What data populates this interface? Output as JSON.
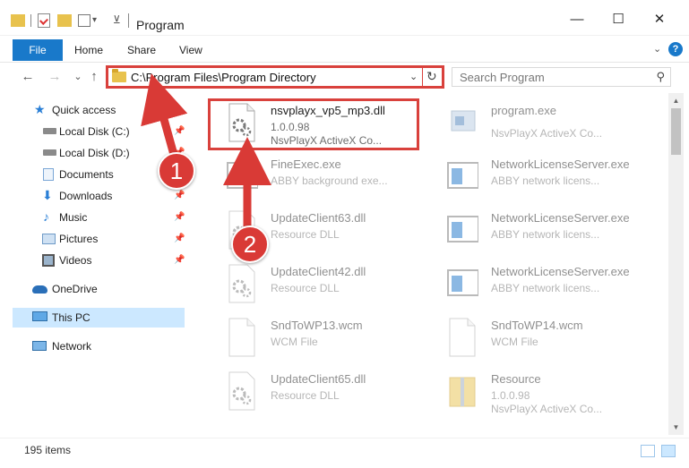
{
  "window": {
    "title": "Program",
    "min_glyph": "—",
    "max_glyph": "☐",
    "close_glyph": "✕"
  },
  "ribbon": {
    "file_label": "File",
    "tabs": [
      "Home",
      "Share",
      "View"
    ],
    "expand_glyph": "⌄",
    "help_glyph": "?"
  },
  "nav": {
    "back_glyph": "←",
    "forward_glyph": "→",
    "recent_glyph": "⌄",
    "up_glyph": "↑"
  },
  "address": {
    "path": "C:\\Program Files\\Program Directory",
    "dropdown_glyph": "⌄",
    "refresh_glyph": "↻"
  },
  "search": {
    "placeholder": "Search Program",
    "icon_glyph": "⚲"
  },
  "sidebar": {
    "items": [
      {
        "label": "Quick access",
        "icon": "star-icon",
        "pinned": false
      },
      {
        "label": "Local Disk (C:)",
        "icon": "drive-icon",
        "pinned": true
      },
      {
        "label": "Local Disk (D:)",
        "icon": "drive-icon",
        "pinned": true
      },
      {
        "label": "Documents",
        "icon": "documents-icon",
        "pinned": true
      },
      {
        "label": "Downloads",
        "icon": "downloads-icon",
        "pinned": true
      },
      {
        "label": "Music",
        "icon": "music-icon",
        "pinned": true
      },
      {
        "label": "Pictures",
        "icon": "pictures-icon",
        "pinned": true
      },
      {
        "label": "Videos",
        "icon": "videos-icon",
        "pinned": true
      },
      {
        "label": "OneDrive",
        "icon": "cloud-icon",
        "pinned": false
      },
      {
        "label": "This PC",
        "icon": "computer-icon",
        "pinned": false,
        "selected": true
      },
      {
        "label": "Network",
        "icon": "network-icon",
        "pinned": false
      }
    ],
    "pin_glyph": "📌"
  },
  "files": [
    {
      "name": "nsvplayx_vp5_mp3.dll",
      "line1": "1.0.0.98",
      "line2": "NsvPlayX ActiveX Co...",
      "type": "dll",
      "highlight": true
    },
    {
      "name": "program.exe",
      "line1": "NsvPlayX ActiveX Co...",
      "line2": "",
      "type": "exe"
    },
    {
      "name": "FineExec.exe",
      "line1": "ABBY background exe...",
      "line2": "",
      "type": "window"
    },
    {
      "name": "NetworkLicenseServer.exe",
      "line1": "ABBY network licens...",
      "line2": "",
      "type": "window"
    },
    {
      "name": "UpdateClient63.dll",
      "line1": "Resource DLL",
      "line2": "",
      "type": "dll"
    },
    {
      "name": "NetworkLicenseServer.exe",
      "line1": "ABBY network licens...",
      "line2": "",
      "type": "window"
    },
    {
      "name": "UpdateClient42.dll",
      "line1": "Resource DLL",
      "line2": "",
      "type": "dll"
    },
    {
      "name": "NetworkLicenseServer.exe",
      "line1": "ABBY network licens...",
      "line2": "",
      "type": "window"
    },
    {
      "name": "SndToWP13.wcm",
      "line1": "WCM File",
      "line2": "",
      "type": "blank"
    },
    {
      "name": "SndToWP14.wcm",
      "line1": "WCM File",
      "line2": "",
      "type": "blank"
    },
    {
      "name": "UpdateClient65.dll",
      "line1": "Resource DLL",
      "line2": "",
      "type": "dll"
    },
    {
      "name": "Resource",
      "line1": "1.0.0.98",
      "line2": "NsvPlayX ActiveX Co...",
      "type": "folderzip"
    }
  ],
  "status": {
    "count": "195 items"
  },
  "annotations": {
    "badge1": "1",
    "badge2": "2"
  },
  "colors": {
    "accent": "#1979ca",
    "highlight_red": "#d9413c",
    "selected_bg": "#cce8ff"
  }
}
